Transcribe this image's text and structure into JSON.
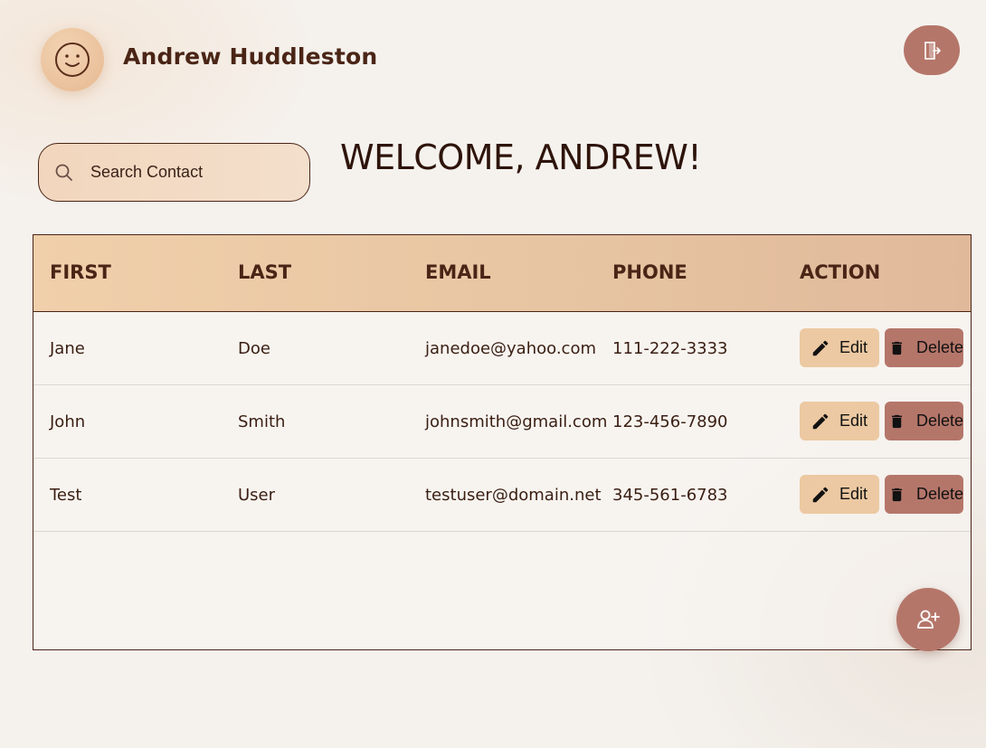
{
  "header": {
    "user_name": "Andrew Huddleston",
    "avatar_icon": "smiley-face-icon",
    "logout_icon": "logout-door-icon"
  },
  "search": {
    "placeholder": "Search Contact",
    "icon": "search-icon"
  },
  "welcome_text": "WELCOME, ANDREW!",
  "table": {
    "columns": [
      "FIRST",
      "LAST",
      "EMAIL",
      "PHONE",
      "ACTION"
    ],
    "rows": [
      {
        "first": "Jane",
        "last": "Doe",
        "email": "janedoe@yahoo.com",
        "phone": "111-222-3333"
      },
      {
        "first": "John",
        "last": "Smith",
        "email": "johnsmith@gmail.com",
        "phone": "123-456-7890"
      },
      {
        "first": "Test",
        "last": "User",
        "email": "testuser@domain.net",
        "phone": "345-561-6783"
      }
    ],
    "edit_label": "Edit",
    "delete_label": "Delete"
  },
  "fab": {
    "icon": "add-person-icon"
  },
  "colors": {
    "accent": "#b5766a",
    "header_bg": "#ecc9a2",
    "text": "#3a1e12"
  }
}
